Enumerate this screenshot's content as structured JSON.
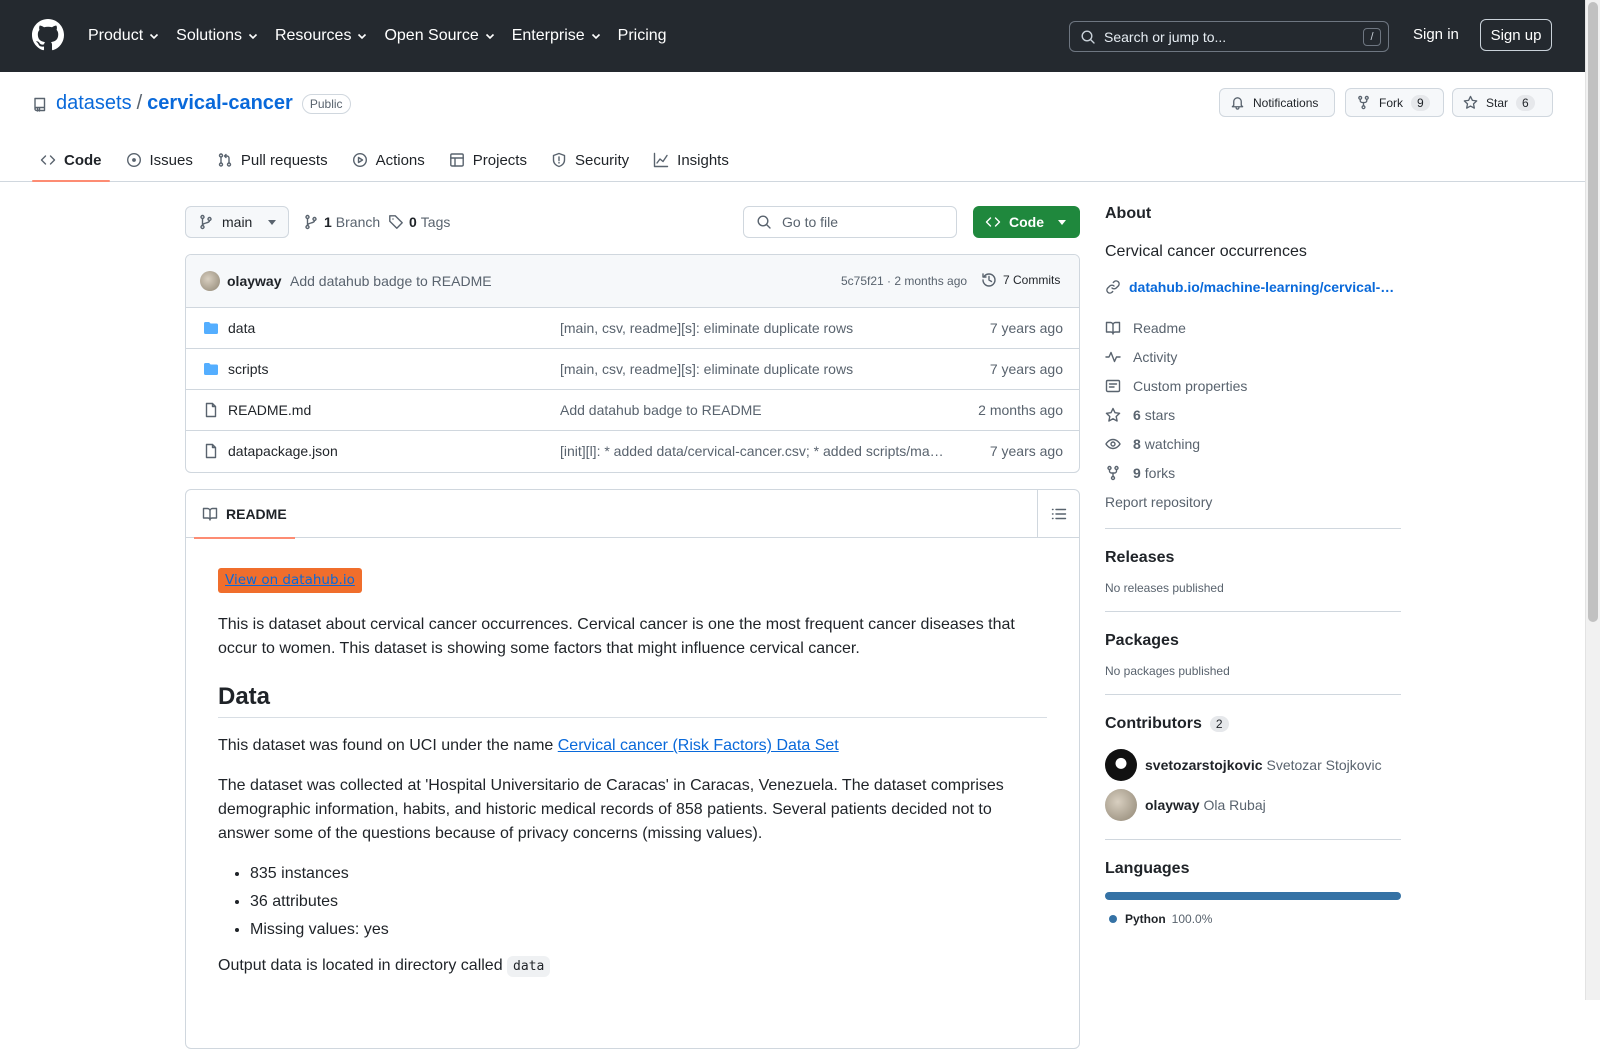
{
  "nav": {
    "items": [
      "Product",
      "Solutions",
      "Resources",
      "Open Source",
      "Enterprise",
      "Pricing"
    ],
    "search_placeholder": "Search or jump to...",
    "slash": "/",
    "signin": "Sign in",
    "signup": "Sign up"
  },
  "repo": {
    "owner": "datasets",
    "sep": "/",
    "name": "cervical-cancer",
    "visibility": "Public",
    "notifications": "Notifications",
    "fork_label": "Fork",
    "fork_count": "9",
    "star_label": "Star",
    "star_count": "6",
    "tabs": [
      "Code",
      "Issues",
      "Pull requests",
      "Actions",
      "Projects",
      "Security",
      "Insights"
    ]
  },
  "toolbar": {
    "branch": "main",
    "branch_count": "1",
    "branch_label": "Branch",
    "tag_count": "0",
    "tag_label": "Tags",
    "go_to_file": "Go to file",
    "code_button": "Code"
  },
  "commit": {
    "author": "olayway",
    "message": "Add datahub badge to README",
    "sha_time": "5c75f21 · 2 months ago",
    "commits": "7 Commits"
  },
  "files": [
    {
      "name": "data",
      "type": "dir",
      "message": "[main, csv, readme][s]: eliminate duplicate rows",
      "time": "7 years ago"
    },
    {
      "name": "scripts",
      "type": "dir",
      "message": "[main, csv, readme][s]: eliminate duplicate rows",
      "time": "7 years ago"
    },
    {
      "name": "README.md",
      "type": "file",
      "message": "Add datahub badge to README",
      "time": "2 months ago"
    },
    {
      "name": "datapackage.json",
      "type": "file",
      "message": "[init][l]: * added data/cervical-cancer.csv; * added scripts/ma…",
      "time": "7 years ago"
    }
  ],
  "readme": {
    "tab": "README",
    "badge": "View on datahub.io",
    "intro": "This is dataset about cervical cancer occurrences. Cervical cancer is one the most frequent cancer diseases that occur to women. This dataset is showing some factors that might influence cervical cancer.",
    "h_data": "Data",
    "found_prefix": "This dataset was found on UCI under the name ",
    "found_link": "Cervical cancer (Risk Factors) Data Set",
    "collected": "The dataset was collected at 'Hospital Universitario de Caracas' in Caracas, Venezuela. The dataset comprises demographic information, habits, and historic medical records of 858 patients. Several patients decided not to answer some of the questions because of privacy concerns (missing values).",
    "bullets": [
      "835 instances",
      "36 attributes",
      "Missing values: yes"
    ],
    "output_prefix": "Output data is located in directory called ",
    "output_code": "data"
  },
  "about": {
    "title": "About",
    "description": "Cervical cancer occurrences",
    "website": "datahub.io/machine-learning/cervical-…",
    "readme": "Readme",
    "activity": "Activity",
    "custom": "Custom properties",
    "stars_n": "6",
    "stars": "stars",
    "watching_n": "8",
    "watching": "watching",
    "forks_n": "9",
    "forks": "forks",
    "report": "Report repository"
  },
  "releases": {
    "title": "Releases",
    "none": "No releases published"
  },
  "packages": {
    "title": "Packages",
    "none": "No packages published"
  },
  "contributors": {
    "title": "Contributors",
    "count": "2",
    "people": [
      {
        "login": "svetozarstojkovic",
        "name": "Svetozar Stojkovic"
      },
      {
        "login": "olayway",
        "name": "Ola Rubaj"
      }
    ]
  },
  "languages": {
    "title": "Languages",
    "name": "Python",
    "percent": "100.0%",
    "share": 1.0,
    "color": "#3572a5"
  }
}
